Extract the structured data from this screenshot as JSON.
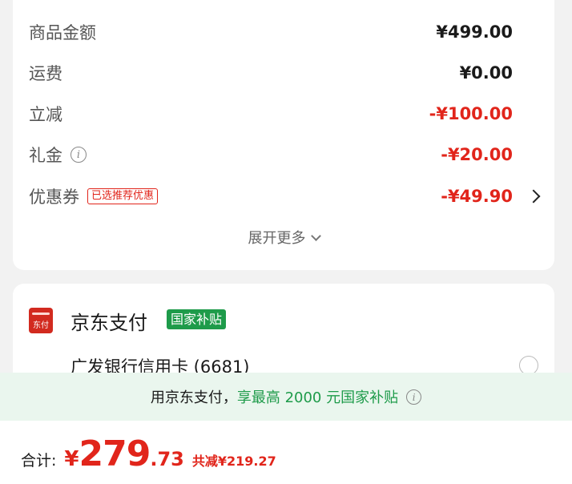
{
  "summary": {
    "rows": [
      {
        "label": "商品金额",
        "value": "¥499.00"
      },
      {
        "label": "运费",
        "value": "¥0.00"
      },
      {
        "label": "立减",
        "value": "-¥100.00"
      },
      {
        "label": "礼金",
        "value": "-¥20.00"
      },
      {
        "label": "优惠券",
        "value": "-¥49.90",
        "tag": "已选推荐优惠"
      }
    ],
    "info_icon_glyph": "i",
    "expand_label": "展开更多"
  },
  "payment": {
    "logo_text": "东付",
    "title": "京东支付",
    "badge": "国家补贴",
    "bank_option": "广发银行信用卡 (6681)"
  },
  "banner": {
    "prefix": "用京东支付，",
    "highlight": "享最高 2000 元国家补贴"
  },
  "total": {
    "label": "合计:",
    "currency": "¥",
    "integer": "279",
    "decimal": ".73",
    "saved": "共减¥219.27"
  },
  "colors": {
    "red": "#e1251b",
    "green": "#1e9b4a",
    "banner_bg": "#eaf6ee"
  },
  "icons": [
    "info-icon",
    "chevron-right-icon",
    "chevron-down-icon",
    "jd-pay-logo-icon",
    "radio-icon"
  ]
}
